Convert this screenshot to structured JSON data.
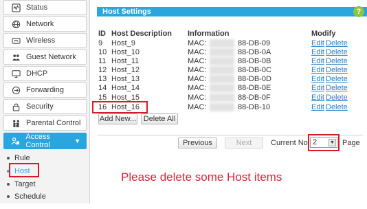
{
  "sidebar": {
    "items": [
      {
        "label": "Status",
        "icon": "status-icon"
      },
      {
        "label": "Network",
        "icon": "globe-icon"
      },
      {
        "label": "Wireless",
        "icon": "wireless-icon"
      },
      {
        "label": "Guest Network",
        "icon": "guest-icon"
      },
      {
        "label": "DHCP",
        "icon": "monitor-icon"
      },
      {
        "label": "Forwarding",
        "icon": "forwarding-icon"
      },
      {
        "label": "Security",
        "icon": "lock-icon"
      },
      {
        "label": "Parental Control",
        "icon": "family-icon"
      },
      {
        "label": "Access Control",
        "icon": "access-control-icon",
        "active": true
      }
    ],
    "sub_items": [
      "Rule",
      "Host",
      "Target",
      "Schedule"
    ],
    "selected_sub": "Host"
  },
  "panel": {
    "title": "Host Settings",
    "help_label": "?",
    "columns": [
      "ID",
      "Host Description",
      "Information",
      "Modify"
    ],
    "rows": [
      {
        "id": "9",
        "desc": "Host_9",
        "mac_label": "MAC:",
        "mac_suffix": "88-DB-09"
      },
      {
        "id": "10",
        "desc": "Host_10",
        "mac_label": "MAC:",
        "mac_suffix": "88-DB-0A"
      },
      {
        "id": "11",
        "desc": "Host_11",
        "mac_label": "MAC:",
        "mac_suffix": "88-DB-0B"
      },
      {
        "id": "12",
        "desc": "Host_12",
        "mac_label": "MAC:",
        "mac_suffix": "88-DB-0C"
      },
      {
        "id": "13",
        "desc": "Host_13",
        "mac_label": "MAC:",
        "mac_suffix": "88-DB-0D"
      },
      {
        "id": "14",
        "desc": "Host_14",
        "mac_label": "MAC:",
        "mac_suffix": "88-DB-0E"
      },
      {
        "id": "15",
        "desc": "Host_15",
        "mac_label": "MAC:",
        "mac_suffix": "88-DB-0F"
      },
      {
        "id": "16",
        "desc": "Host_16",
        "mac_label": "MAC:",
        "mac_suffix": "88-DB-10"
      }
    ],
    "edit_label": "Edit",
    "delete_label": "Delete",
    "add_new_label": "Add New...",
    "delete_all_label": "Delete All",
    "previous_label": "Previous",
    "next_label": "Next",
    "current_no_label": "Current No",
    "current_page": "2",
    "page_label": "Page"
  },
  "annotation": "Please delete some Host items",
  "colors": {
    "accent": "#2aa6df",
    "highlight": "#d8192a",
    "note": "#e0233a"
  }
}
